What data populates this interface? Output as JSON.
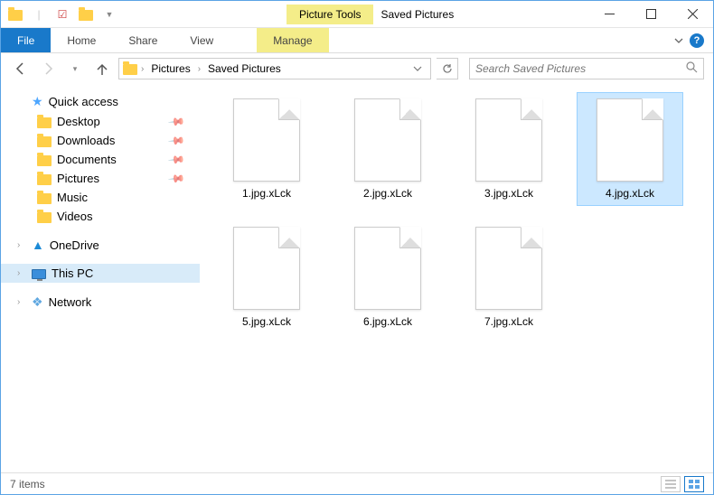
{
  "titlebar": {
    "context_tab": "Picture Tools",
    "title": "Saved Pictures"
  },
  "ribbon": {
    "file": "File",
    "tabs": [
      "Home",
      "Share",
      "View"
    ],
    "context_tab": "Manage"
  },
  "address": {
    "crumbs": [
      "Pictures",
      "Saved Pictures"
    ]
  },
  "search": {
    "placeholder": "Search Saved Pictures"
  },
  "sidebar": {
    "quick_access": {
      "label": "Quick access",
      "items": [
        {
          "label": "Desktop",
          "pinned": true
        },
        {
          "label": "Downloads",
          "pinned": true
        },
        {
          "label": "Documents",
          "pinned": true
        },
        {
          "label": "Pictures",
          "pinned": true
        },
        {
          "label": "Music",
          "pinned": false
        },
        {
          "label": "Videos",
          "pinned": false
        }
      ]
    },
    "onedrive": {
      "label": "OneDrive"
    },
    "thispc": {
      "label": "This PC"
    },
    "network": {
      "label": "Network"
    }
  },
  "files": [
    {
      "name": "1.jpg.xLck",
      "selected": false
    },
    {
      "name": "2.jpg.xLck",
      "selected": false
    },
    {
      "name": "3.jpg.xLck",
      "selected": false
    },
    {
      "name": "4.jpg.xLck",
      "selected": true
    },
    {
      "name": "5.jpg.xLck",
      "selected": false
    },
    {
      "name": "6.jpg.xLck",
      "selected": false
    },
    {
      "name": "7.jpg.xLck",
      "selected": false
    }
  ],
  "statusbar": {
    "count_text": "7 items"
  }
}
